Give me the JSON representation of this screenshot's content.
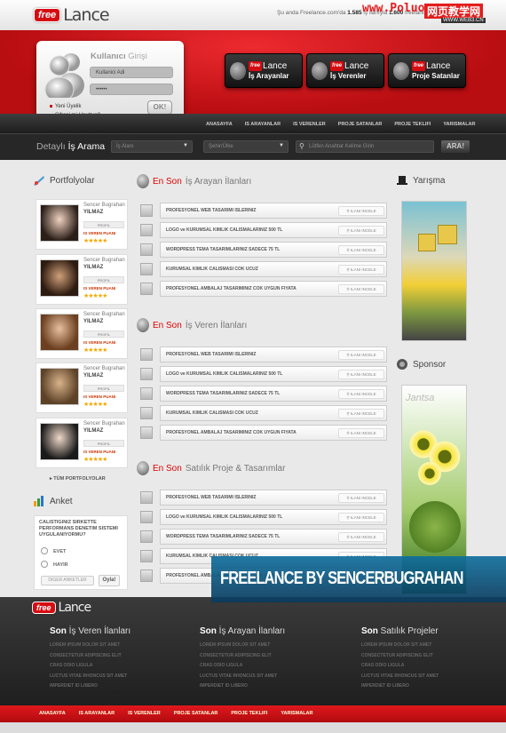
{
  "watermark": {
    "site": "www.Poluo",
    "cn": "网页教学网",
    "url": "WWW.WEB3.CN"
  },
  "header": {
    "logo_free": "free",
    "logo_lance": "Lance",
    "stats_prefix": "Şu anda Freelance.com'da",
    "stats_n1": "1.585",
    "stats_mid": "iş ilanıyla",
    "stats_n2": "1.600",
    "stats_suffix": "freelance çalışan"
  },
  "login": {
    "title_a": "Kullanıcı",
    "title_b": " Girişi",
    "user_placeholder": "Kullanici Adi",
    "password_value": "••••••",
    "link_register": "Yeni Üyelik",
    "link_forgot": "Şifreni mi Unuttun?",
    "ok_label": "OK!"
  },
  "hero_buttons": [
    {
      "free": "free",
      "lance": "Lance",
      "label": "İş Arayanlar"
    },
    {
      "free": "free",
      "lance": "Lance",
      "label": "İş Verenler"
    },
    {
      "free": "free",
      "lance": "Lance",
      "label": "Proje Satanlar"
    }
  ],
  "nav": [
    "ANASAYFA",
    "IS ARAYANLAR",
    "IS VERENLER",
    "PROJE SATANLAR",
    "PROJE TEKLIFI",
    "YARISMALAR"
  ],
  "search": {
    "title_a": "Detaylı",
    "title_b": " İş Arama",
    "sel1": "İş Alanı",
    "sel2": "Şehir/Ülke",
    "kw_placeholder": "Lütfen Anahtar Kelime Girin",
    "btn": "ARA!"
  },
  "portfolio": {
    "title": "Portfolyolar",
    "items": [
      {
        "name1": "Sencer Bugrahan",
        "name2": "YILMAZ",
        "profile": "PROFIL",
        "rating_label": "IS VEREN PUANI",
        "stars": "★★★★★"
      },
      {
        "name1": "Sencer Bugrahan",
        "name2": "YILMAZ",
        "profile": "PROFIL",
        "rating_label": "IS VEREN PUANI",
        "stars": "★★★★★"
      },
      {
        "name1": "Sencer Bugrahan",
        "name2": "YILMAZ",
        "profile": "PROFIL",
        "rating_label": "IS VEREN PUANI",
        "stars": "★★★★★"
      },
      {
        "name1": "Sencer Bugrahan",
        "name2": "YILMAZ",
        "profile": "PROFIL",
        "rating_label": "IS VEREN PUANI",
        "stars": "★★★★★"
      },
      {
        "name1": "Sencer Bugrahan",
        "name2": "YILMAZ",
        "profile": "PROFIL",
        "rating_label": "IS VEREN PUANI",
        "stars": "★★★★★"
      }
    ],
    "all_link": "▸ TÜM PORTFOLYOLAR"
  },
  "poll": {
    "title": "Anket",
    "question": "CALISTIGINIZ SIRKETTE PERFORMANS DENETIM SISTEMI UYGULANIYORMU?",
    "options": [
      "EVET",
      "HAYIR"
    ],
    "others": "DIGER ANKETLER",
    "vote": "Oyla!"
  },
  "listings": [
    {
      "red": "En Son",
      "gray": " İş Arayan İlanları",
      "rows": [
        "PROFESYONEL WEB TASARIMI ISLERINIZ",
        "LOGO ve KURUMSAL KIMLIK CALISMALARINIZ 500 TL",
        "WORDPRESS TEMA TASARIMLARINIZ SADECE 75 TL",
        "KURUMSAL KIMLIK CALISMASI COK UCUZ",
        "PROFESYONEL AMBALAJ TASARIMINIZ COK UYGUN FIYATA"
      ]
    },
    {
      "red": "En Son",
      "gray": " İş Veren İlanları",
      "rows": [
        "PROFESYONEL WEB TASARIMI ISLERINIZ",
        "LOGO ve KURUMSAL KIMLIK CALISMALARINIZ 500 TL",
        "WORDPRESS TEMA TASARIMLARINIZ SADECE 75 TL",
        "KURUMSAL KIMLIK CALISMASI COK UCUZ",
        "PROFESYONEL AMBALAJ TASARIMINIZ COK UYGUN FIYATA"
      ]
    },
    {
      "red": "En Son",
      "gray": " Satılık Proje & Tasarımlar",
      "rows": [
        "PROFESYONEL WEB TASARIMI ISLERINIZ",
        "LOGO ve KURUMSAL KIMLIK CALISMALARINIZ 500 TL",
        "WORDPRESS TEMA TASARIMLARINIZ SADECE 75 TL",
        "KURUMSAL KIMLIK CALISMASI COK UCUZ",
        "PROFESYONEL AMBALAJ TASARIMINIZ COK UYGUN FIYATA"
      ]
    }
  ],
  "detail_label": "ILANI INCELE",
  "right": {
    "contest": "Yarışma",
    "sponsor": "Sponsor",
    "ad_text": "Jantsa"
  },
  "banner": "FREELANCE BY SENCERBUGRAHAN",
  "footer": {
    "logo_free": "free",
    "logo_lance": "Lance",
    "cols": [
      {
        "a": "Son",
        "b": " İş Veren İlanları"
      },
      {
        "a": "Son",
        "b": " İş Arayan İlanları"
      },
      {
        "a": "Son",
        "b": " Satılık Projeler"
      }
    ],
    "lines": [
      "LOREM IPSUM DOLOR SIT AMET",
      "CONSECTETUR ADIPISCING ELIT",
      "CRAS ODIO LIGULA",
      "LUCTUS VITAE RHONCUS SIT AMET",
      "IMPERDIET ID LIBERO"
    ],
    "nav": [
      "ANASAYFA",
      "IS ARAYANLAR",
      "IS VERENLER",
      "PROJE SATANLAR",
      "PROJE TEKLIFI",
      "YARISMALAR"
    ]
  },
  "colors": {
    "brand_red": "#d50d12",
    "dark": "#1f1f1f",
    "accent_blue": "#0f6f9e"
  }
}
